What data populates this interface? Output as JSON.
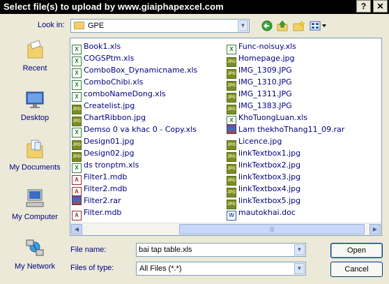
{
  "window": {
    "title": "Select file(s) to upload by www.giaiphapexcel.com",
    "help_label": "?",
    "close_label": "✕"
  },
  "lookin": {
    "label": "Look in:",
    "value": "GPE"
  },
  "toolbar": {
    "back_icon": "back-icon",
    "up_icon": "up-folder-icon",
    "newfolder_icon": "new-folder-icon",
    "views_icon": "views-menu-icon"
  },
  "places": [
    {
      "label": "Recent",
      "icon": "recent-icon"
    },
    {
      "label": "Desktop",
      "icon": "desktop-icon"
    },
    {
      "label": "My Documents",
      "icon": "my-documents-icon"
    },
    {
      "label": "My Computer",
      "icon": "my-computer-icon"
    },
    {
      "label": "My Network",
      "icon": "my-network-icon"
    }
  ],
  "files": {
    "col1": [
      {
        "name": "Book1.xls",
        "type": "xls"
      },
      {
        "name": "COGSPtm.xls",
        "type": "xls"
      },
      {
        "name": "ComboBox_Dynamicname.xls",
        "type": "xls"
      },
      {
        "name": "ComboChibi.xls",
        "type": "xls"
      },
      {
        "name": "comboNameDong.xls",
        "type": "xls"
      },
      {
        "name": "Createlist.jpg",
        "type": "jpg"
      },
      {
        "name": "ChartRibbon.jpg",
        "type": "jpg"
      },
      {
        "name": "Demso 0 va khac 0 - Copy.xls",
        "type": "xls"
      },
      {
        "name": "Design01.jpg",
        "type": "jpg"
      },
      {
        "name": "Design02.jpg",
        "type": "jpg"
      },
      {
        "name": "ds tronptm.xls",
        "type": "xls"
      },
      {
        "name": "Filter1.mdb",
        "type": "mdb"
      },
      {
        "name": "Filter2.mdb",
        "type": "mdb"
      },
      {
        "name": "Filter2.rar",
        "type": "rar"
      },
      {
        "name": "Filter.mdb",
        "type": "mdb"
      }
    ],
    "col2": [
      {
        "name": "Func-noisuy.xls",
        "type": "xls"
      },
      {
        "name": "Homepage.jpg",
        "type": "jpg"
      },
      {
        "name": "IMG_1309.JPG",
        "type": "jpg"
      },
      {
        "name": "IMG_1310.JPG",
        "type": "jpg"
      },
      {
        "name": "IMG_1311.JPG",
        "type": "jpg"
      },
      {
        "name": "IMG_1383.JPG",
        "type": "jpg"
      },
      {
        "name": "KhoTuongLuan.xls",
        "type": "xls"
      },
      {
        "name": "Lam thekhoThang11_09.rar",
        "type": "rar"
      },
      {
        "name": "Licence.jpg",
        "type": "jpg"
      },
      {
        "name": "linkTextbox1.jpg",
        "type": "jpg"
      },
      {
        "name": "linkTextbox2.jpg",
        "type": "jpg"
      },
      {
        "name": "linkTextbox3.jpg",
        "type": "jpg"
      },
      {
        "name": "linkTextbox4.jpg",
        "type": "jpg"
      },
      {
        "name": "linkTextbox5.jpg",
        "type": "jpg"
      },
      {
        "name": "mautokhai.doc",
        "type": "doc"
      }
    ]
  },
  "filename": {
    "label": "File name:",
    "value": "bai tap table.xls"
  },
  "filetype": {
    "label": "Files of type:",
    "value": "All Files (*.*)"
  },
  "buttons": {
    "open": "Open",
    "cancel": "Cancel"
  },
  "colors": {
    "label_blue": "#000080",
    "dialog_bg": "#ece9d8"
  }
}
